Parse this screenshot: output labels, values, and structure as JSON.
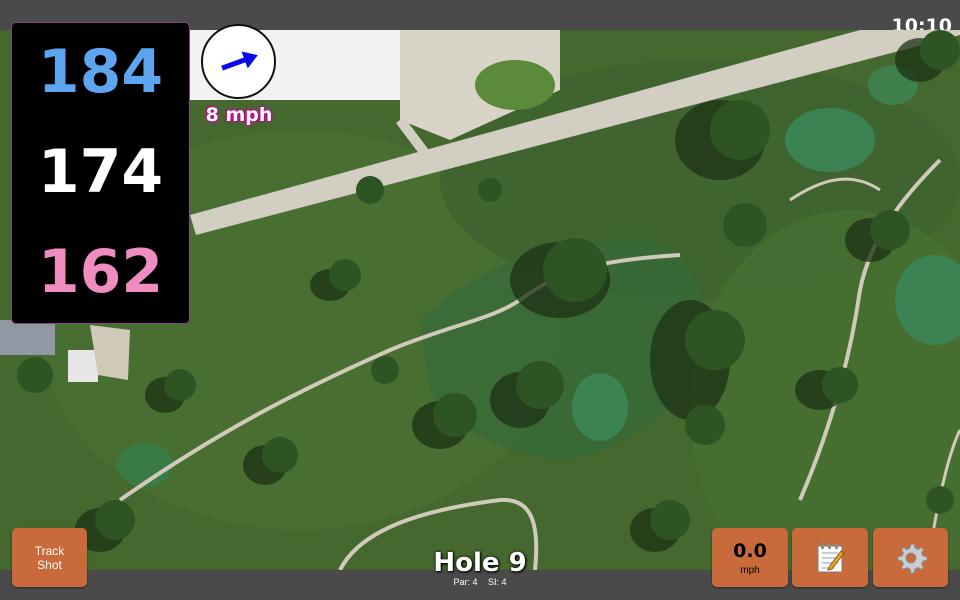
{
  "status": {
    "time": "10:10"
  },
  "distances": {
    "back": "184",
    "center": "174",
    "front": "162"
  },
  "wind": {
    "speed_label": "8 mph",
    "direction_icon": "wind-arrow-icon",
    "arrow_color": "#0a0ae6"
  },
  "buttons": {
    "track_shot_line1": "Track",
    "track_shot_line2": "Shot",
    "wind_value": "0.0",
    "wind_unit": "mph",
    "notes_icon": "notepad-icon",
    "settings_icon": "gear-icon"
  },
  "hole": {
    "title": "Hole 9",
    "par": "Par: 4",
    "si": "SI: 4"
  },
  "colors": {
    "back_distance": "#5ea5ef",
    "center_distance": "#ffffff",
    "front_distance": "#ef8cc0",
    "button": "#c96a3a",
    "bar": "#4a4a4a"
  }
}
